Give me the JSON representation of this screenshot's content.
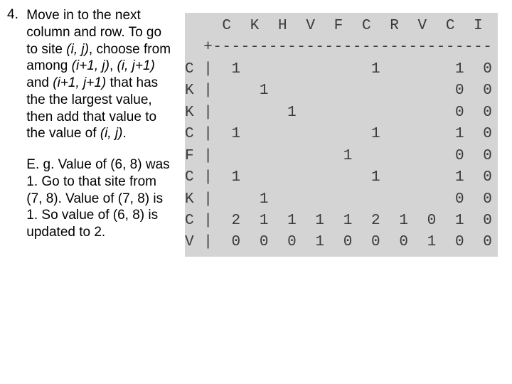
{
  "item_number": "4.",
  "para1_prefix": "Move in to the next column and row. To go to site ",
  "ij": "(i, j)",
  "para1_mid1": ", choose from among ",
  "i1j": "(i+1, j)",
  "comma_sp": ", ",
  "ij1": "(i, j+1)",
  "para1_mid2": " and ",
  "i1j1": "(i+1, j+1)",
  "para1_mid3": " that has the the largest value, then add that value to the value of ",
  "ij2": "(i, j)",
  "period": ".",
  "para2": "E. g. Value of (6, 8) was 1.  Go to that site from (7, 8). Value of (7, 8) is 1. So value of (6, 8) is updated to 2.",
  "chart_data": {
    "type": "table",
    "title": "",
    "col_headers": [
      "C",
      "K",
      "H",
      "V",
      "F",
      "C",
      "R",
      "V",
      "C",
      "I"
    ],
    "row_headers": [
      "C",
      "K",
      "K",
      "C",
      "F",
      "C",
      "K",
      "C",
      "V"
    ],
    "rows": [
      [
        "1",
        "",
        "",
        "",
        "",
        "1",
        "",
        "",
        "1",
        "0"
      ],
      [
        "",
        "1",
        "",
        "",
        "",
        "",
        "",
        "",
        "0",
        "0"
      ],
      [
        "",
        "",
        "1",
        "",
        "",
        "",
        "",
        "",
        "0",
        "0"
      ],
      [
        "1",
        "",
        "",
        "",
        "",
        "1",
        "",
        "",
        "1",
        "0"
      ],
      [
        "",
        "",
        "",
        "",
        "1",
        "",
        "",
        "",
        "0",
        "0"
      ],
      [
        "1",
        "",
        "",
        "",
        "",
        "1",
        "",
        "",
        "1",
        "0"
      ],
      [
        "",
        "1",
        "",
        "",
        "",
        "",
        "",
        "",
        "0",
        "0"
      ],
      [
        "2",
        "1",
        "1",
        "1",
        "1",
        "2",
        "1",
        "0",
        "1",
        "0"
      ],
      [
        "0",
        "0",
        "0",
        "1",
        "0",
        "0",
        "0",
        "1",
        "0",
        "0"
      ]
    ]
  },
  "matrix_lines": [
    "    C  K  H  V  F  C  R  V  C  I",
    "  +------------------------------",
    "C |  1              1        1  0",
    "K |     1                    0  0",
    "K |        1                 0  0",
    "C |  1              1        1  0",
    "F |              1           0  0",
    "C |  1              1        1  0",
    "K |     1                    0  0",
    "C |  2  1  1  1  1  2  1  0  1  0",
    "V |  0  0  0  1  0  0  0  1  0  0"
  ]
}
